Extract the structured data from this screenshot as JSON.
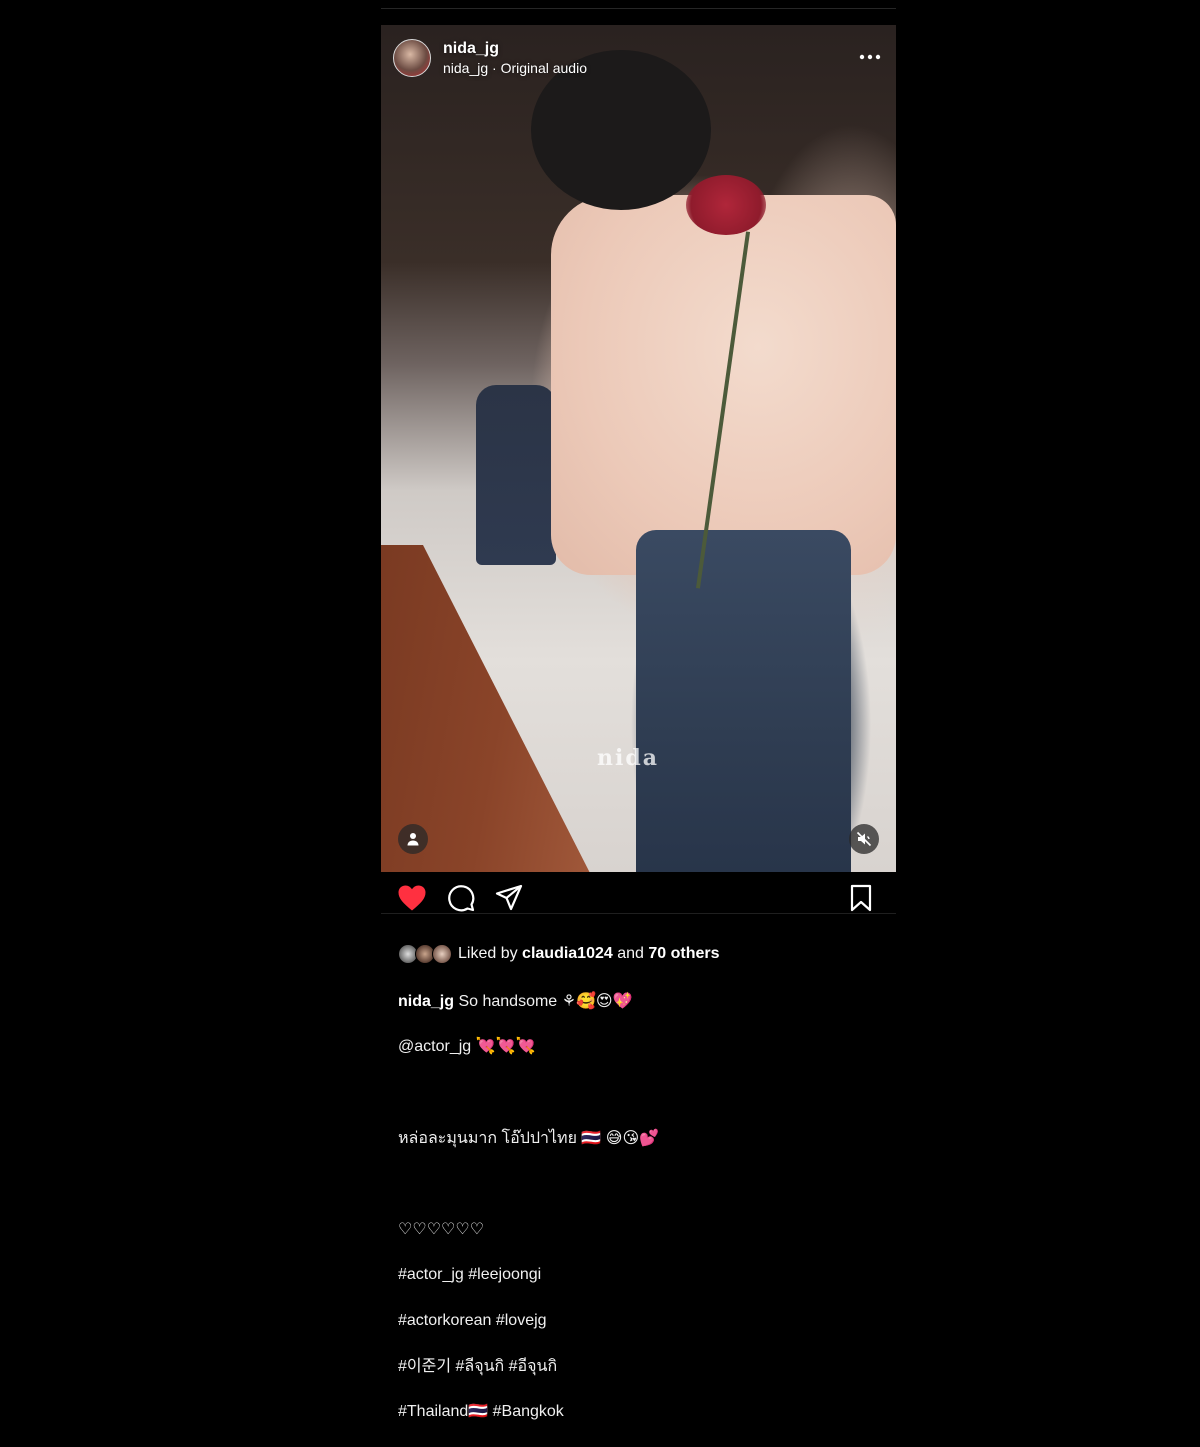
{
  "post": {
    "username": "nida_jg",
    "audio_line": "nida_jg · Original audio",
    "watermark": "nida",
    "more_icon": "more-horizontal-icon"
  },
  "media_controls": {
    "tagged_icon": "person-icon",
    "mute_icon": "speaker-muted-icon"
  },
  "actions": {
    "like_icon": "heart-filled-icon",
    "like_color": "#ff3040",
    "comment_icon": "comment-icon",
    "share_icon": "send-icon",
    "save_icon": "bookmark-icon"
  },
  "likes": {
    "prefix": "Liked by",
    "user": "claudia1024",
    "middle": "and",
    "others": "70 others"
  },
  "caption": {
    "author": "nida_jg",
    "line1": "So handsome ⚘🥰😍💖",
    "line2": "@actor_jg 💘💘💘",
    "line3": "หล่อละมุนมาก โอ๊ปปาไทย 🇹🇭 😅😘💕",
    "line4": "♡♡♡♡♡♡",
    "line5": "#actor_jg #leejoongi",
    "line6": "#actorkorean #lovejg",
    "line7": "#이준기 #ลีจุนกิ #อีจุนกิ",
    "line8": "#Thailand🇹🇭 #Bangkok"
  }
}
